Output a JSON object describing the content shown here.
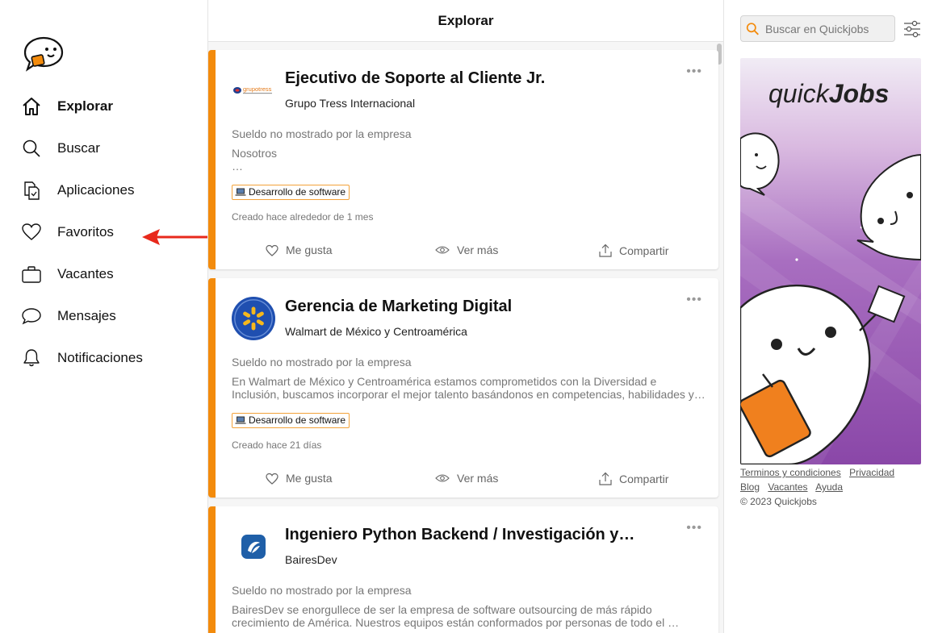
{
  "app": {
    "name": "Quickjobs"
  },
  "sidebar": {
    "items": [
      {
        "label": "Explorar",
        "icon": "home-icon",
        "active": true
      },
      {
        "label": "Buscar",
        "icon": "search-icon",
        "active": false
      },
      {
        "label": "Aplicaciones",
        "icon": "documents-icon",
        "active": false
      },
      {
        "label": "Favoritos",
        "icon": "heart-icon",
        "active": false
      },
      {
        "label": "Vacantes",
        "icon": "briefcase-icon",
        "active": false
      },
      {
        "label": "Mensajes",
        "icon": "chat-bubble-icon",
        "active": false
      },
      {
        "label": "Notificaciones",
        "icon": "bell-icon",
        "active": false
      }
    ],
    "annotation_arrow_color": "#e8291c"
  },
  "main": {
    "title": "Explorar",
    "accent_color": "#f38b0c",
    "jobs": [
      {
        "title": "Ejecutivo de Soporte al Cliente Jr.",
        "company": "Grupo Tress Internacional",
        "logo": "grupo-tress-logo",
        "logo_text": "grupotress",
        "salary": "Sueldo no mostrado por la empresa",
        "description_line1": "Nosotros",
        "description_line2": "…",
        "tag": "Desarrollo de software",
        "created": "Creado hace alrededor de 1 mes"
      },
      {
        "title": "Gerencia de Marketing Digital",
        "company": "Walmart de México y Centroamérica",
        "logo": "walmart-logo",
        "salary": "Sueldo no mostrado por la empresa",
        "description_line1": "En Walmart de México y Centroamérica estamos comprometidos con la Diversidad e",
        "description_line2": "Inclusión, buscamos incorporar el mejor talento basándonos en competencias, habilidades y…",
        "tag": "Desarrollo de software",
        "created": "Creado hace 21 días"
      },
      {
        "title": "Ingeniero Python Backend / Investigación y…",
        "company": "BairesDev",
        "logo": "bairesdev-logo",
        "salary": "Sueldo no mostrado por la empresa",
        "description_line1": "BairesDev se enorgullece de ser la empresa de software outsourcing de más rápido",
        "description_line2": "crecimiento de América. Nuestros equipos están conformados por personas de todo el …"
      }
    ],
    "actions": {
      "like": "Me gusta",
      "view": "Ver más",
      "share": "Compartir"
    },
    "more_label": "•••"
  },
  "right": {
    "search_placeholder": "Buscar en Quickjobs",
    "banner_brand_prefix": "quick",
    "banner_brand_suffix": "Jobs",
    "footer": {
      "terms": "Terminos y condiciones",
      "privacy": "Privacidad",
      "blog": "Blog",
      "vacancies": "Vacantes",
      "help": "Ayuda",
      "copyright": "© 2023 Quickjobs"
    }
  }
}
